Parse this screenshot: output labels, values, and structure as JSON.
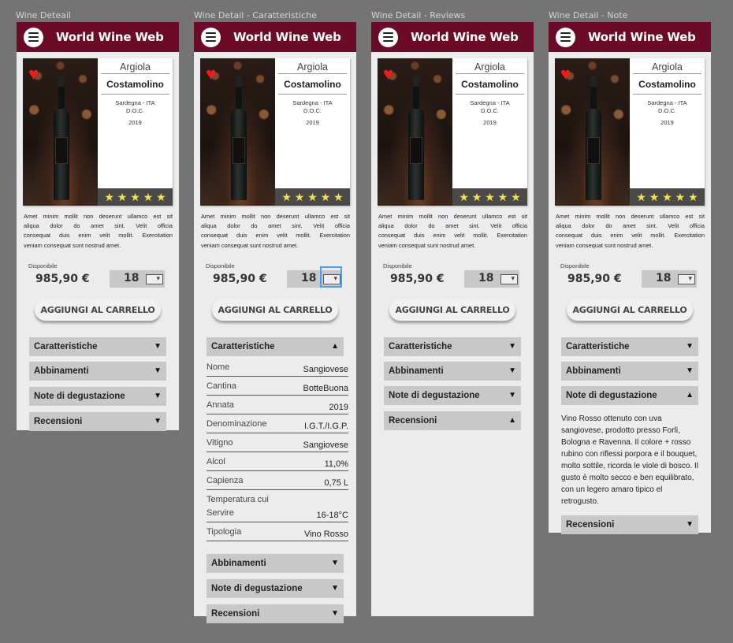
{
  "app": {
    "title": "World Wine Web",
    "menu_icon": "hamburger-icon"
  },
  "frames": [
    {
      "label": "Wine Deteail"
    },
    {
      "label": "Wine Detail - Caratteristiche"
    },
    {
      "label": "Wine Detail - Reviews"
    },
    {
      "label": "Wine Detail - Note"
    }
  ],
  "wine": {
    "producer": "Argiola",
    "name": "Costamolino",
    "region": "Sardegna - ITA",
    "classification": "D.O.C.",
    "year": "2019",
    "stars": "★ ★ ★ ★ ★",
    "rating": 5,
    "favorite_icon": "heart-icon",
    "description_lines": [
      "Amet minim mollit non deserunt ullamco est sit",
      "aliqua dolor do amet sint. Velit officia",
      "consequat duis enim velit mollit. Exercitation",
      "veniam consequat sunt nostrud amet."
    ],
    "availability": "Disponibile",
    "price": "985,90 €",
    "quantity": "18",
    "cart_button": "AGGIUNGI AL CARRELLO"
  },
  "sections": {
    "caratteristiche": "Caratteristiche",
    "abbinamenti": "Abbinamenti",
    "note": "Note di degustazione",
    "recensioni": "Recensioni"
  },
  "arrows": {
    "down": "▼",
    "up": "▲"
  },
  "specs": [
    {
      "key": "Nome",
      "value": "Sangiovese"
    },
    {
      "key": "Cantina",
      "value": "BotteBuona"
    },
    {
      "key": "Annata",
      "value": "2019"
    },
    {
      "key": "Denominazione",
      "value": "I.G.T./I.G.P."
    },
    {
      "key": "Vitigno",
      "value": "Sangiovese"
    },
    {
      "key": "Alcol",
      "value": "11,0%"
    },
    {
      "key": "Capienza",
      "value": "0,75 L"
    },
    {
      "key": "Temperatura cui Servire",
      "value": "16-18°C"
    },
    {
      "key": "Tipologia",
      "value": "Vino Rosso"
    }
  ],
  "note_text": "Vino Rosso ottenuto con uva sangiovese, prodotto presso Forlì, Bologna e Ravenna. Il colore + rosso rubino con riflessi porpora e il bouquet, molto sottile, ricorda le viole di bosco. Il gusto è molto secco e ben equilibrato, con un legero amaro tipico el retrogusto.",
  "colors": {
    "header": "#6b0b27",
    "accordion": "#c8c8c8",
    "star": "#f7e04a",
    "heart": "#f01c1c",
    "focus": "#4a9ff0"
  }
}
